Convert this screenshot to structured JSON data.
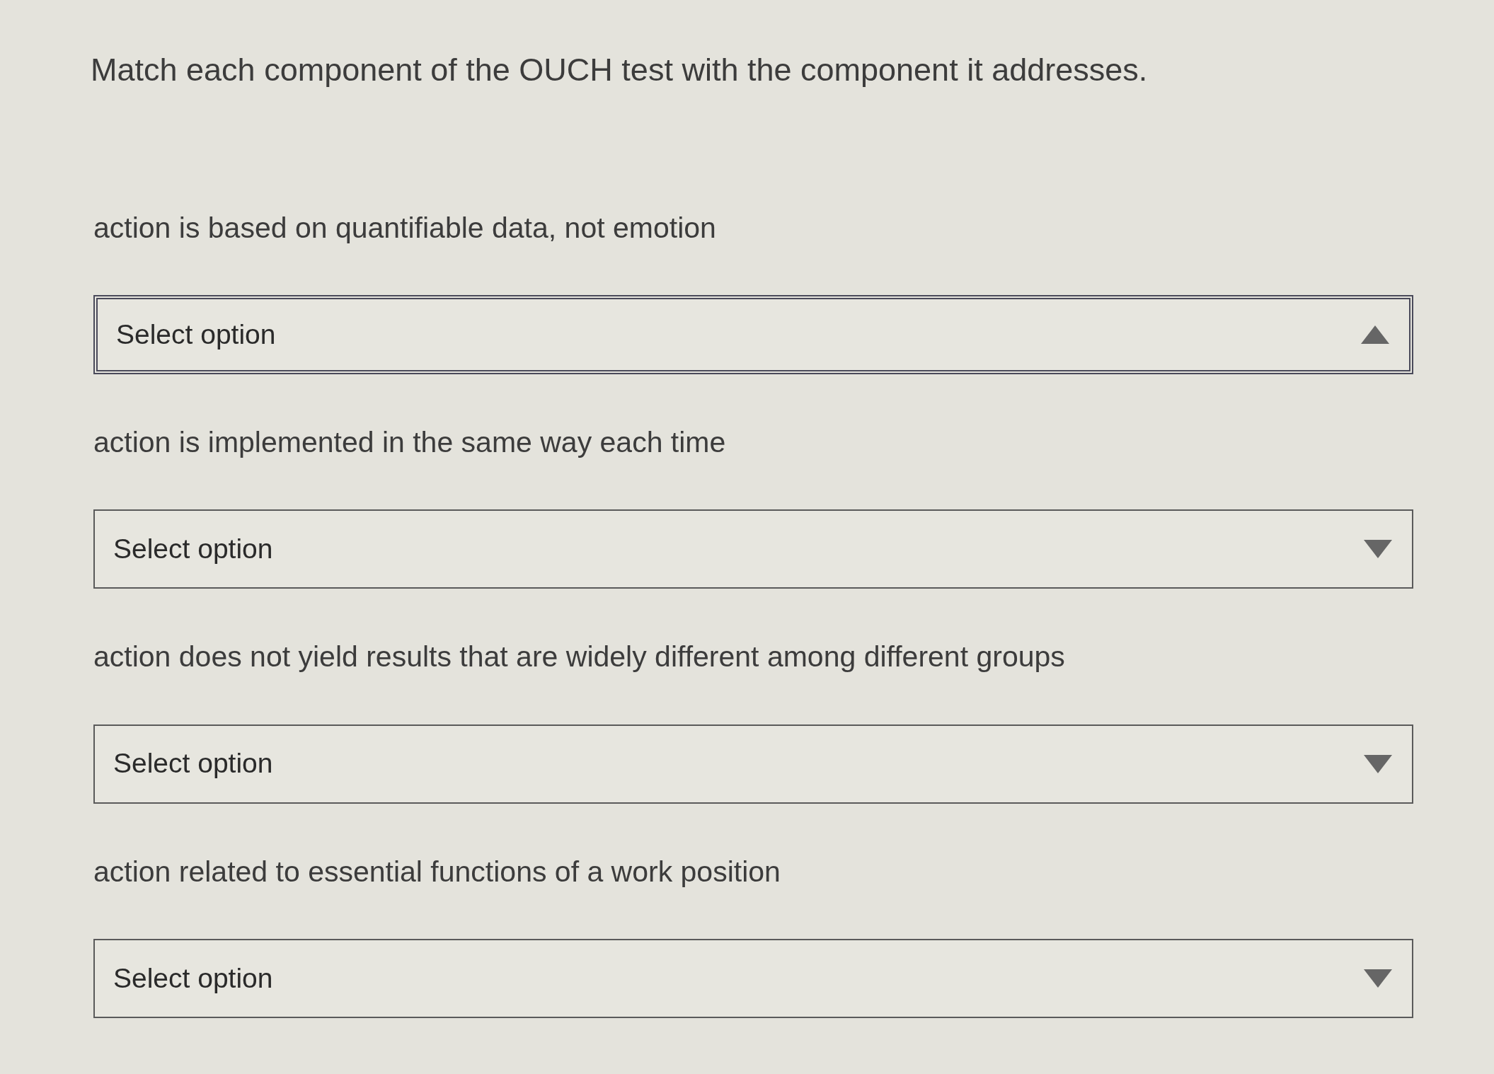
{
  "question": {
    "title": "Match each component of the OUCH test with the component it addresses."
  },
  "items": [
    {
      "prompt": "action is based on quantifiable data, not emotion",
      "dropdown": {
        "placeholder": "Select option",
        "expanded": true
      }
    },
    {
      "prompt": "action is implemented in the same way each time",
      "dropdown": {
        "placeholder": "Select option",
        "expanded": false
      }
    },
    {
      "prompt": "action does not yield results that are widely different among different groups",
      "dropdown": {
        "placeholder": "Select option",
        "expanded": false
      }
    },
    {
      "prompt": "action related to essential functions of a work position",
      "dropdown": {
        "placeholder": "Select option",
        "expanded": false
      }
    }
  ]
}
